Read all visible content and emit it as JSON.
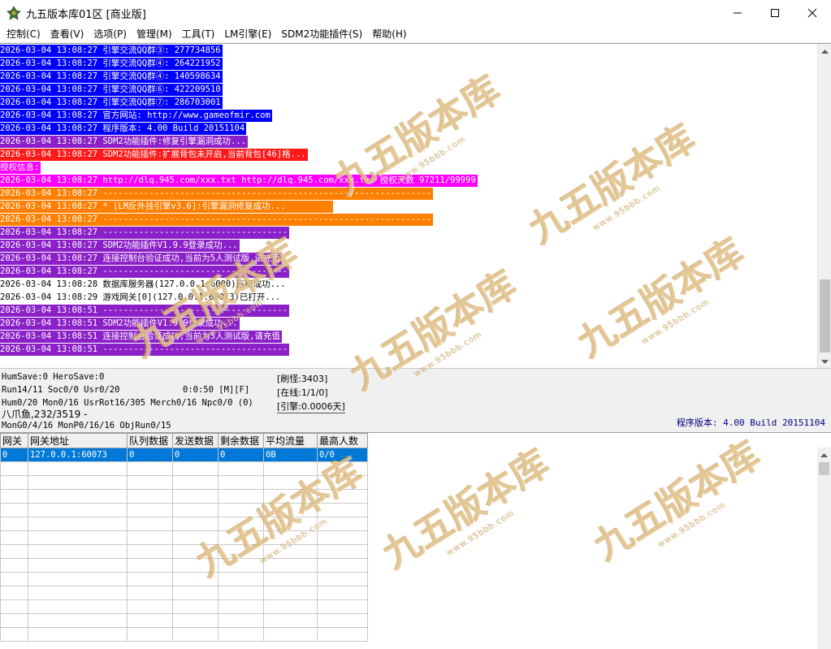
{
  "window": {
    "title": "九五版本库01区 [商业版]",
    "controls": {
      "minimize": "minimize-icon",
      "maximize": "maximize-icon",
      "close": "close-icon"
    }
  },
  "menu": {
    "items": [
      {
        "label": "控制(C)"
      },
      {
        "label": "查看(V)"
      },
      {
        "label": "选项(P)"
      },
      {
        "label": "管理(M)"
      },
      {
        "label": "工具(T)"
      },
      {
        "label": "LM引擎(E)"
      },
      {
        "label": "SDM2功能插件(S)"
      },
      {
        "label": "帮助(H)"
      }
    ]
  },
  "log": {
    "lines": [
      {
        "text": "2026-03-04 13:08:27 引擎交流QQ群③: 277734856",
        "color": "blue"
      },
      {
        "text": "2026-03-04 13:08:27 引擎交流QQ群④: 264221952",
        "color": "blue"
      },
      {
        "text": "2026-03-04 13:08:27 引擎交流QQ群④: 140598634",
        "color": "blue"
      },
      {
        "text": "2026-03-04 13:08:27 引擎交流QQ群⑥: 422209510",
        "color": "blue"
      },
      {
        "text": "2026-03-04 13:08:27 引擎交流QQ群⑦: 286703001",
        "color": "blue"
      },
      {
        "text": "2026-03-04 13:08:27 官方网站: http://www.gameofmir.com",
        "color": "blue"
      },
      {
        "text": "2026-03-04 13:08:27 程序版本: 4.00 Build 20151104",
        "color": "blue"
      },
      {
        "text": "2026-03-04 13:08:27 SDM2功能插件:修复引擎漏洞成功...",
        "color": "purple"
      },
      {
        "text": "2026-03-04 13:08:27 SDM2功能插件:扩展背包未开启,当前背包[46]格...",
        "color": "red"
      },
      {
        "text": "授权信息:",
        "color": "magenta"
      },
      {
        "text": "2026-03-04 13:08:27 http://dlq.945.com/xxx.txt http://dlq.945.com/xxx.txt 授权天数 97211/99999",
        "color": "magenta"
      },
      {
        "text": "2026-03-04 13:08:27 ----------------------------------------------------------------",
        "color": "orange"
      },
      {
        "text": "2026-03-04 13:08:27 * [LM反外挂引擎v3.6]:引擎漏洞修复成功...         ",
        "color": "orange"
      },
      {
        "text": "2026-03-04 13:08:27 ----------------------------------------------------------------",
        "color": "orange"
      },
      {
        "text": "2026-03-04 13:08:27 ------------------------------------",
        "color": "purple"
      },
      {
        "text": "2026-03-04 13:08:27 SDM2功能插件V1.9.9登录成功...",
        "color": "purple"
      },
      {
        "text": "2026-03-04 13:08:27 连接控制台验证成功,当前为5人测试版,请充值",
        "color": "purple"
      },
      {
        "text": "2026-03-04 13:08:27 ------------------------------------",
        "color": "purple"
      },
      {
        "text": "2026-03-04 13:08:28 数据库服务器(127.0.0.1:6000)连接成功...",
        "color": "plain"
      },
      {
        "text": "2026-03-04 13:08:29 游戏网关[0](127.0.0.1:60073)已打开...",
        "color": "plain"
      },
      {
        "text": "2026-03-04 13:08:51 ------------------------------------",
        "color": "purple"
      },
      {
        "text": "2026-03-04 13:08:51 SDM2功能插件V1.9.9登录成功...",
        "color": "purple"
      },
      {
        "text": "2026-03-04 13:08:51 连接控制台验证成功,当前为5人测试版,请充值",
        "color": "purple"
      },
      {
        "text": "2026-03-04 13:08:51 ------------------------------------",
        "color": "purple"
      }
    ]
  },
  "status": {
    "line1": "HumSave:0 HeroSave:0",
    "line2": "Run14/11 Soc0/0 Usr0/20",
    "timer": "0:0:50 [M][F]",
    "line3": "Hum0/20 Mon0/16 UsrRot16/305 Merch0/16 Npc0/0 (0)",
    "line4": "八爪鱼,232/3519 -",
    "line5": "MonG0/4/16 MonP0/16/16 ObjRun0/15",
    "refresh_monsters": "[刷怪:3403]",
    "online": "[在线:1/1/0]",
    "engine": "[引擎:0.0006天]",
    "version": "程序版本: 4.00 Build 20151104"
  },
  "grid": {
    "headers": [
      "网关",
      "网关地址",
      "队列数据",
      "发送数据",
      "剩余数据",
      "平均流量",
      "最高人数"
    ],
    "rows": [
      {
        "cells": [
          "0",
          "127.0.0.1:60073",
          "0",
          "0",
          "0",
          "0B",
          "0/0"
        ],
        "selected": true
      }
    ],
    "empty_rows": 13
  },
  "watermark": {
    "text": "九五版本库",
    "sub": "www.95bbb.com"
  },
  "colors": {
    "blue": "#0000ff",
    "purple": "#8b20c8",
    "red": "#ff1a1a",
    "magenta": "#ff00ff",
    "orange": "#ff7f00",
    "selection": "#0078d7"
  }
}
